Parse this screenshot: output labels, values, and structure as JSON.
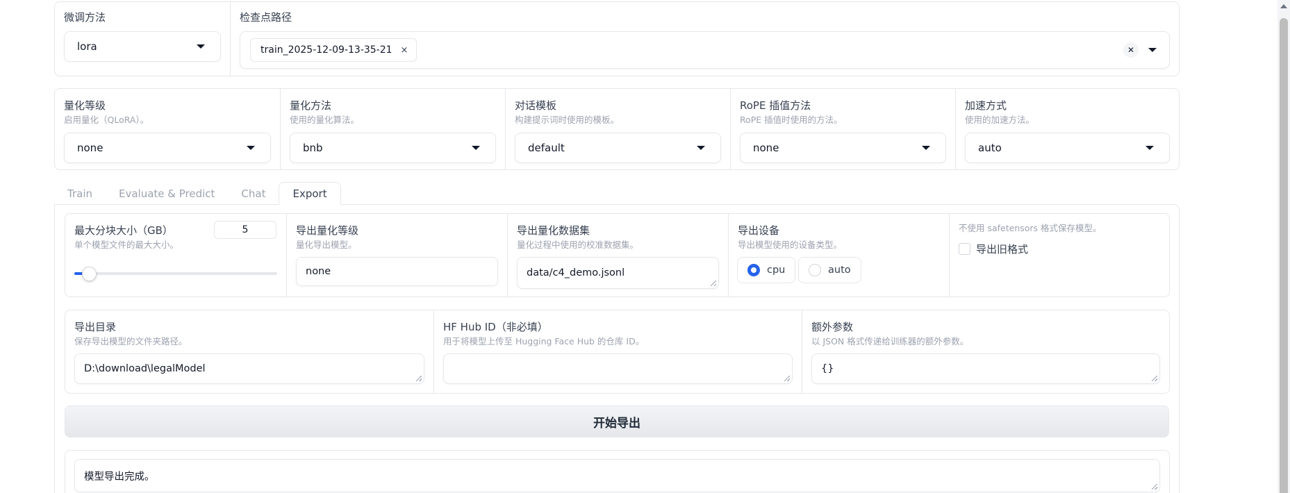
{
  "finetune": {
    "label": "微调方法",
    "value": "lora"
  },
  "checkpoint": {
    "label": "检查点路径",
    "tag": "train_2025-12-09-13-35-21",
    "tag_remove": "×",
    "clear": "✕"
  },
  "row2": [
    {
      "label": "量化等级",
      "info": "启用量化（QLoRA）。",
      "value": "none"
    },
    {
      "label": "量化方法",
      "info": "使用的量化算法。",
      "value": "bnb"
    },
    {
      "label": "对话模板",
      "info": "构建提示词时使用的模板。",
      "value": "default"
    },
    {
      "label": "RoPE 插值方法",
      "info": "RoPE 插值时使用的方法。",
      "value": "none"
    },
    {
      "label": "加速方式",
      "info": "使用的加速方法。",
      "value": "auto"
    }
  ],
  "tabs": [
    {
      "label": "Train",
      "active": false
    },
    {
      "label": "Evaluate & Predict",
      "active": false
    },
    {
      "label": "Chat",
      "active": false
    },
    {
      "label": "Export",
      "active": true
    }
  ],
  "export": {
    "shard_size": {
      "label": "最大分块大小（GB）",
      "info": "单个模型文件的最大大小。",
      "value": "5",
      "slider_min": 1,
      "slider_max": 100,
      "slider_value": 5
    },
    "quant_bit": {
      "label": "导出量化等级",
      "info": "量化导出模型。",
      "value": "none"
    },
    "quant_dataset": {
      "label": "导出量化数据集",
      "info": "量化过程中使用的校准数据集。",
      "value": "data/c4_demo.jsonl"
    },
    "device": {
      "label": "导出设备",
      "info": "导出模型使用的设备类型。",
      "options": [
        "cpu",
        "auto"
      ],
      "selected": "cpu"
    },
    "legacy": {
      "info": "不使用 safetensors 格式保存模型。",
      "label": "导出旧格式",
      "checked": false
    },
    "dir": {
      "label": "导出目录",
      "info": "保存导出模型的文件夹路径。",
      "value": "D:\\download\\legalModel"
    },
    "hub": {
      "label": "HF Hub ID（非必填）",
      "info": "用于将模型上传至 Hugging Face Hub 的仓库 ID。",
      "value": ""
    },
    "extra": {
      "label": "额外参数",
      "info": "以 JSON 格式传递给训练器的额外参数。",
      "value": "{}"
    },
    "button": "开始导出",
    "output": "模型导出完成。"
  },
  "colors": {
    "accent": "#2563eb",
    "border": "#e5e7eb",
    "muted": "#9ca3af"
  }
}
